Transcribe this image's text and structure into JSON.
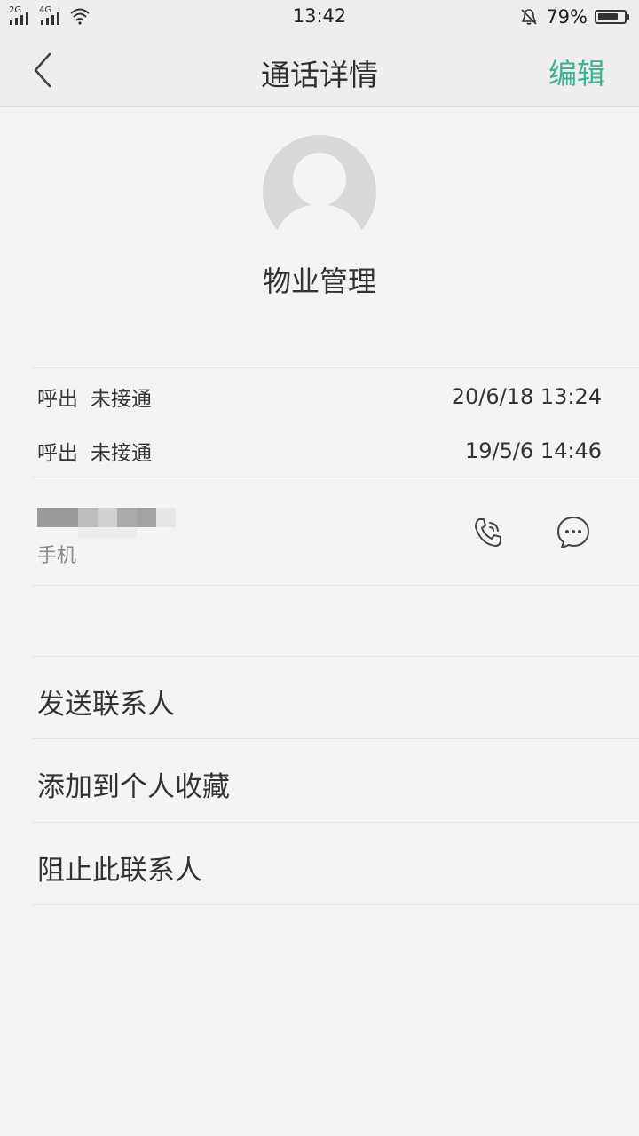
{
  "status_bar": {
    "sim1_label": "2G",
    "sim2_label": "4G",
    "time": "13:42",
    "battery_percent": "79%",
    "battery_level": 0.79,
    "icons": [
      "signal-icon",
      "signal-icon",
      "wifi-icon",
      "bell-muted-icon",
      "battery-icon"
    ]
  },
  "header": {
    "title": "通话详情",
    "edit_label": "编辑",
    "back_icon": "chevron-left-icon",
    "accent_color": "#3bb394"
  },
  "contact": {
    "name": "物业管理",
    "avatar_icon": "person-avatar-icon"
  },
  "call_log": [
    {
      "direction": "呼出",
      "status": "未接通",
      "time": "20/6/18 13:24"
    },
    {
      "direction": "呼出",
      "status": "未接通",
      "time": "19/5/6 14:46"
    }
  ],
  "phone": {
    "type_label": "手机",
    "call_icon": "phone-call-icon",
    "message_icon": "message-icon"
  },
  "menu": {
    "items": [
      {
        "label": "发送联系人"
      },
      {
        "label": "添加到个人收藏"
      },
      {
        "label": "阻止此联系人"
      }
    ]
  }
}
